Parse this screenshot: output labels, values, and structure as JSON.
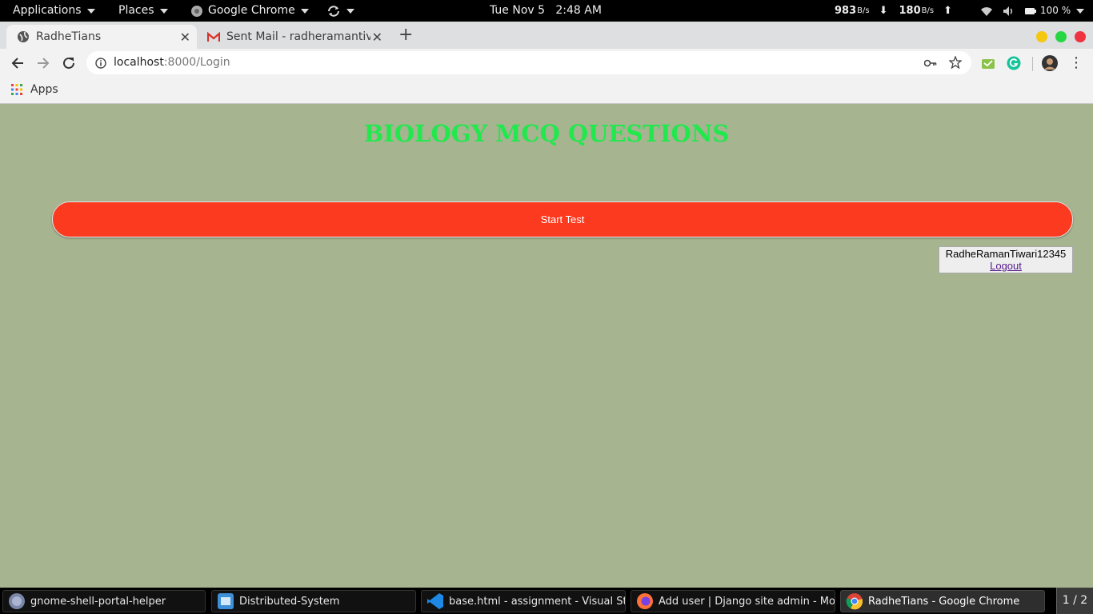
{
  "topbar": {
    "applications": "Applications",
    "places": "Places",
    "app_name": "Google Chrome",
    "clock": "Tue Nov 5   2:48 AM",
    "net_down": "983",
    "net_down_unit": "B/s",
    "net_up": "180",
    "net_up_unit": "B/s",
    "battery": "100 %"
  },
  "tabs": [
    {
      "title": "RadheTians",
      "active": true
    },
    {
      "title": "Sent Mail - radheramantiv",
      "active": false
    }
  ],
  "address": {
    "host": "localhost",
    "path": ":8000/Login"
  },
  "bookmarks": {
    "apps_label": "Apps"
  },
  "page": {
    "heading": "BIOLOGY MCQ QUESTIONS",
    "start_button": "Start Test",
    "username": "RadheRamanTiwari12345",
    "logout": "Logout"
  },
  "taskbar": {
    "items": [
      {
        "label": "gnome-shell-portal-helper"
      },
      {
        "label": "Distributed-System"
      },
      {
        "label": "base.html - assignment - Visual St..."
      },
      {
        "label": "Add user | Django site admin - Mo..."
      },
      {
        "label": "RadheTians - Google Chrome"
      }
    ],
    "workspace": "1 / 2"
  },
  "colors": {
    "page_bg": "#a6b490",
    "heading": "#22e84e",
    "start_button": "#fc3a1f"
  }
}
